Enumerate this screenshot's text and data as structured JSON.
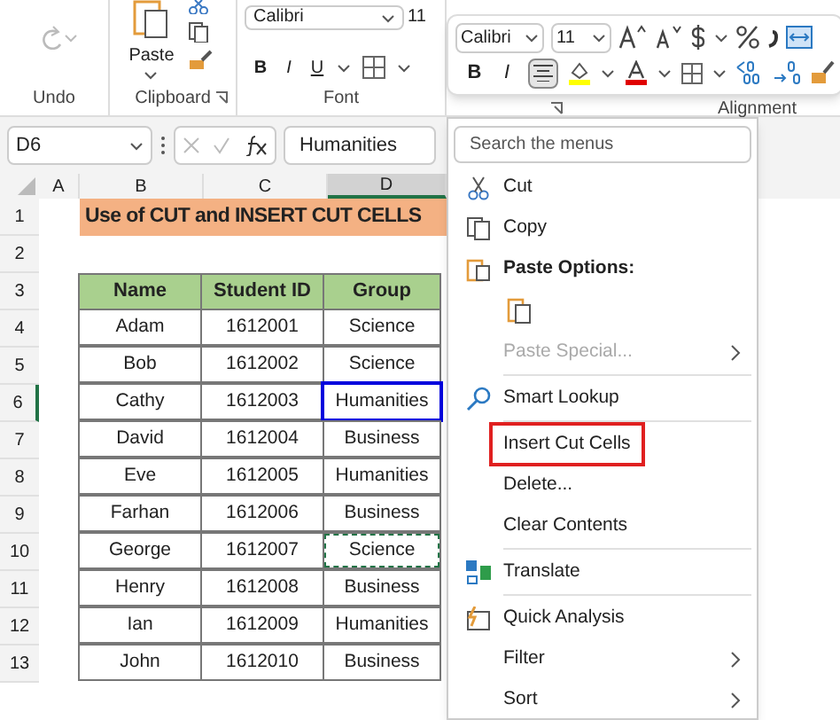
{
  "ribbon": {
    "groups": [
      {
        "label": "Undo"
      },
      {
        "label": "Clipboard"
      },
      {
        "label": "Font"
      }
    ],
    "paste_label": "Paste",
    "font_name": "Calibri",
    "font_size": "11",
    "format_buttons": [
      "B",
      "I",
      "U"
    ],
    "alignment_label": "Alignment"
  },
  "mini_toolbar": {
    "font_name": "Calibri",
    "font_size": "11",
    "format_buttons": [
      {
        "label": "B",
        "selected": false
      },
      {
        "label": "I",
        "selected": false
      }
    ],
    "align_center_selected": true
  },
  "formula_bar": {
    "name_box": "D6",
    "value": "Humanities"
  },
  "sheet": {
    "columns": [
      {
        "label": "A",
        "selected": false
      },
      {
        "label": "B",
        "selected": false
      },
      {
        "label": "C",
        "selected": false
      },
      {
        "label": "D",
        "selected": true
      }
    ],
    "row_numbers": [
      {
        "label": "1",
        "selected": false
      },
      {
        "label": "2",
        "selected": false
      },
      {
        "label": "3",
        "selected": false
      },
      {
        "label": "4",
        "selected": false
      },
      {
        "label": "5",
        "selected": false
      },
      {
        "label": "6",
        "selected": true
      },
      {
        "label": "7",
        "selected": false
      },
      {
        "label": "8",
        "selected": false
      },
      {
        "label": "9",
        "selected": false
      },
      {
        "label": "10",
        "selected": false
      },
      {
        "label": "11",
        "selected": false
      },
      {
        "label": "12",
        "selected": false
      },
      {
        "label": "13",
        "selected": false
      }
    ],
    "title": "Use of CUT and INSERT CUT CELLS",
    "table": {
      "columns": [
        "Name",
        "Student ID",
        "Group"
      ],
      "rows": [
        {
          "cells": [
            "Adam",
            "1612001",
            "Science"
          ],
          "selected": false,
          "cut": false
        },
        {
          "cells": [
            "Bob",
            "1612002",
            "Science"
          ],
          "selected": false,
          "cut": false
        },
        {
          "cells": [
            "Cathy",
            "1612003",
            "Humanities"
          ],
          "selected": true,
          "cut": false
        },
        {
          "cells": [
            "David",
            "1612004",
            "Business"
          ],
          "selected": false,
          "cut": false
        },
        {
          "cells": [
            "Eve",
            "1612005",
            "Humanities"
          ],
          "selected": false,
          "cut": false
        },
        {
          "cells": [
            "Farhan",
            "1612006",
            "Business"
          ],
          "selected": false,
          "cut": false
        },
        {
          "cells": [
            "George",
            "1612007",
            "Science"
          ],
          "selected": false,
          "cut": true
        },
        {
          "cells": [
            "Henry",
            "1612008",
            "Business"
          ],
          "selected": false,
          "cut": false
        },
        {
          "cells": [
            "Ian",
            "1612009",
            "Humanities"
          ],
          "selected": false,
          "cut": false
        },
        {
          "cells": [
            "John",
            "1612010",
            "Business"
          ],
          "selected": false,
          "cut": false
        }
      ]
    }
  },
  "context_menu": {
    "search": {
      "placeholder": "Search the menus"
    },
    "items": [
      {
        "kind": "command",
        "label": "Cut",
        "disabled": false,
        "submenu": false,
        "highlighted": false
      },
      {
        "kind": "command",
        "label": "Copy",
        "disabled": false,
        "submenu": false,
        "highlighted": false
      },
      {
        "kind": "header",
        "label": "Paste Options:"
      },
      {
        "kind": "paste-option"
      },
      {
        "kind": "command",
        "label": "Paste Special...",
        "disabled": true,
        "submenu": true,
        "highlighted": false
      },
      {
        "kind": "divider"
      },
      {
        "kind": "command",
        "label": "Smart Lookup",
        "disabled": false,
        "submenu": false,
        "highlighted": false
      },
      {
        "kind": "divider"
      },
      {
        "kind": "command",
        "label": "Insert Cut Cells",
        "disabled": false,
        "submenu": false,
        "highlighted": true
      },
      {
        "kind": "command",
        "label": "Delete...",
        "disabled": false,
        "submenu": false,
        "highlighted": false
      },
      {
        "kind": "command",
        "label": "Clear Contents",
        "disabled": false,
        "submenu": false,
        "highlighted": false
      },
      {
        "kind": "divider"
      },
      {
        "kind": "command",
        "label": "Translate",
        "disabled": false,
        "submenu": false,
        "highlighted": false
      },
      {
        "kind": "divider"
      },
      {
        "kind": "command",
        "label": "Quick Analysis",
        "disabled": false,
        "submenu": false,
        "highlighted": false
      },
      {
        "kind": "command",
        "label": "Filter",
        "disabled": false,
        "submenu": true,
        "highlighted": false
      },
      {
        "kind": "command",
        "label": "Sort",
        "disabled": false,
        "submenu": true,
        "highlighted": false
      }
    ]
  }
}
